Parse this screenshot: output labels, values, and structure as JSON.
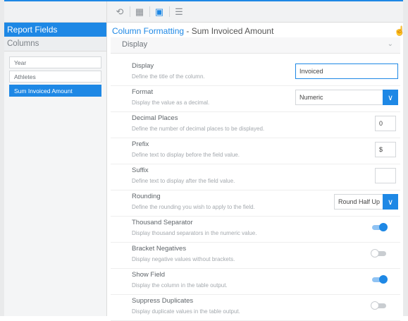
{
  "toolbar": {
    "buttons": [
      {
        "icon": "undo-icon",
        "glyph": "⟲"
      },
      {
        "icon": "table-view-icon",
        "glyph": "▦"
      },
      {
        "icon": "column-format-icon",
        "glyph": "▣"
      },
      {
        "icon": "list-icon",
        "glyph": "☰"
      }
    ]
  },
  "sidebar": {
    "title": "Report Fields",
    "subtitle": "Columns",
    "fields": [
      "Year",
      "Athletes",
      "Sum Invoiced Amount"
    ],
    "selected_index": 2
  },
  "main": {
    "title": "Column Formatting",
    "title_suffix": " - Sum Invoiced Amount",
    "section": "Display",
    "cursor_icon": "hand-pointer-icon",
    "rows": {
      "display": {
        "label": "Display",
        "desc": "Define the title of the column.",
        "value": "Invoiced"
      },
      "format": {
        "label": "Format",
        "desc": "Display the value as a decimal.",
        "value": "Numeric"
      },
      "decimal": {
        "label": "Decimal Places",
        "desc": "Define the number of decimal places to be displayed.",
        "value": "0"
      },
      "prefix": {
        "label": "Prefix",
        "desc": "Define text to display before the field value.",
        "value": "$"
      },
      "suffix": {
        "label": "Suffix",
        "desc": "Define text to display after the field value.",
        "value": ""
      },
      "rounding": {
        "label": "Rounding",
        "desc": "Define the rounding you wish to apply to the field.",
        "value": "Round Half Up"
      },
      "thousand": {
        "label": "Thousand Separator",
        "desc": "Display thousand separators in the numeric value.",
        "on": true
      },
      "brackets": {
        "label": "Bracket Negatives",
        "desc": "Display negative values without brackets.",
        "on": false
      },
      "show": {
        "label": "Show Field",
        "desc": "Display the column in the table output.",
        "on": true
      },
      "duplicates": {
        "label": "Suppress Duplicates",
        "desc": "Display duplicate values in the table output.",
        "on": false
      }
    }
  },
  "colors": {
    "accent": "#1e88e5"
  }
}
